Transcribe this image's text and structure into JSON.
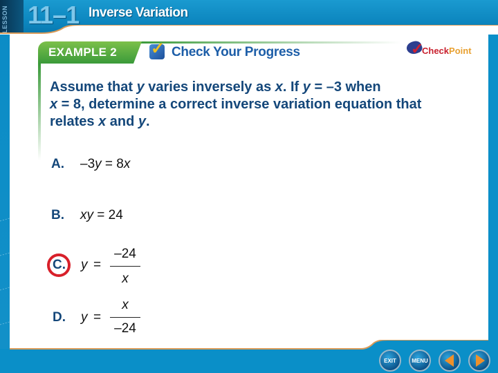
{
  "header": {
    "lesson_label": "LESSON",
    "lesson_number": "11–1",
    "lesson_title": "Inverse Variation"
  },
  "banner": {
    "example_label": "EXAMPLE 2",
    "progress_title": "Check Your Progress",
    "checkpoint_check": "Check",
    "checkpoint_point": "Point"
  },
  "question": {
    "parts": [
      "Assume that ",
      "y",
      " varies inversely as ",
      "x",
      ". If ",
      "y",
      " = –3 when ",
      "x",
      " = 8, determine a correct inverse variation equation that relates ",
      "x",
      " and ",
      "y",
      "."
    ]
  },
  "options": [
    {
      "letter": "A.",
      "lhs": "–3",
      "var1": "y",
      "mid": " = 8",
      "var2": "x"
    },
    {
      "letter": "B.",
      "lhs": "",
      "var1": "xy",
      "mid": " = 24",
      "var2": ""
    },
    {
      "letter": "C.",
      "y": "y",
      "eq": "=",
      "numerator": "–24",
      "denominator": "x",
      "selected": true
    },
    {
      "letter": "D.",
      "y": "y",
      "eq": "=",
      "numerator": "x",
      "denominator": "–24"
    }
  ],
  "nav": {
    "exit_label": "EXIT",
    "menu_label": "MENU",
    "prev": "previous-slide",
    "next": "next-slide"
  },
  "colors": {
    "frame_blue": "#0a8fc8",
    "text_navy": "#14477a",
    "banner_green": "#3a9a3a",
    "answer_circle": "#d8202a",
    "accent_orange": "#f0902a"
  }
}
